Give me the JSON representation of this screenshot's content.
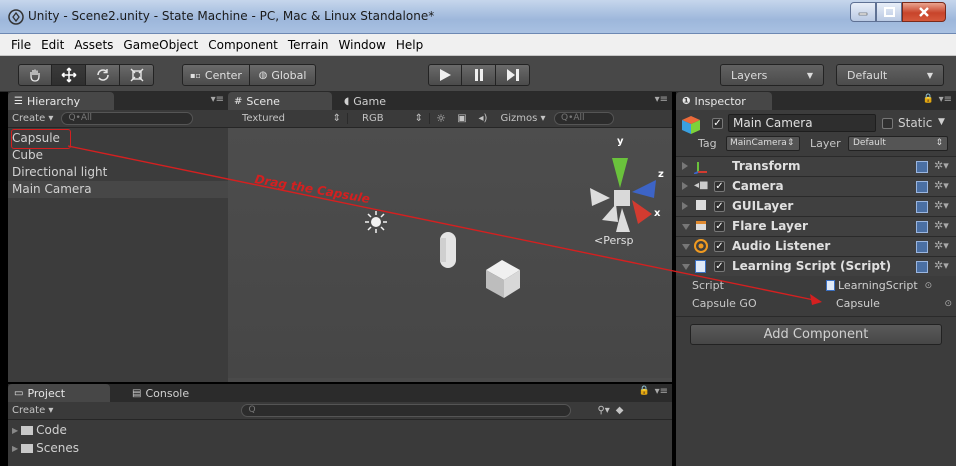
{
  "window": {
    "title": "Unity - Scene2.unity - State Machine - PC, Mac & Linux Standalone*"
  },
  "menu": [
    "File",
    "Edit",
    "Assets",
    "GameObject",
    "Component",
    "Terrain",
    "Window",
    "Help"
  ],
  "toolbar": {
    "pivot_label": "Center",
    "space_label": "Global",
    "layers_label": "Layers",
    "layout_label": "Default"
  },
  "hierarchy": {
    "tab": "Hierarchy",
    "create_label": "Create",
    "search_placeholder": "Q•All",
    "items": [
      "Capsule",
      "Cube",
      "Directional light",
      "Main Camera"
    ]
  },
  "scene": {
    "tab_scene": "Scene",
    "tab_game": "Game",
    "render_mode": "Textured",
    "color_mode": "RGB",
    "gizmos_label": "Gizmos",
    "search_placeholder": "Q•All",
    "persp_label": "Persp",
    "axis_y": "y",
    "axis_z": "z",
    "axis_x": "x"
  },
  "annotation": {
    "text": "Drag the Capsule",
    "color": "#d42020"
  },
  "inspector": {
    "tab": "Inspector",
    "object_name": "Main Camera",
    "static_label": "Static",
    "tag_label": "Tag",
    "tag_value": "MainCamera",
    "layer_label": "Layer",
    "layer_value": "Default",
    "components": [
      "Transform",
      "Camera",
      "GUILayer",
      "Flare Layer",
      "Audio Listener",
      "Learning Script (Script)"
    ],
    "script_field_label": "Script",
    "script_field_value": "LearningScript",
    "capsule_field_label": "Capsule GO",
    "capsule_field_value": "Capsule",
    "add_component_label": "Add Component"
  },
  "project": {
    "tab_project": "Project",
    "tab_console": "Console",
    "create_label": "Create",
    "folders": [
      "Code",
      "Scenes"
    ]
  }
}
